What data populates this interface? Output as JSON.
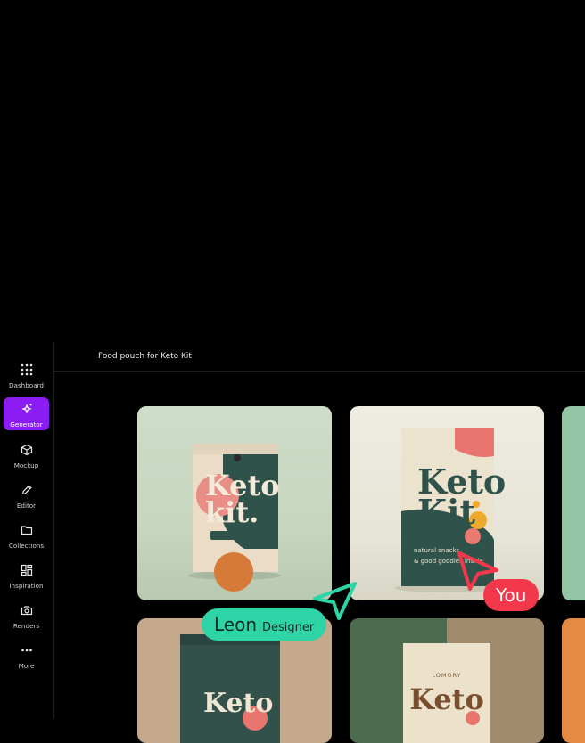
{
  "nav": {
    "items": [
      {
        "label": "Dashboard",
        "icon": "dots-grid-icon"
      },
      {
        "label": "Generator",
        "icon": "sparkle-icon",
        "active": true
      },
      {
        "label": "Mockup",
        "icon": "box-icon"
      },
      {
        "label": "Editor",
        "icon": "pencil-icon"
      },
      {
        "label": "Collections",
        "icon": "folder-icon"
      },
      {
        "label": "Inspiration",
        "icon": "layout-icon"
      },
      {
        "label": "Renders",
        "icon": "camera-icon"
      },
      {
        "label": "More",
        "icon": "ellipsis-icon"
      }
    ]
  },
  "header": {
    "title": "Food pouch for Keto Kit"
  },
  "gallery": {
    "card1": {
      "line1": "Keto",
      "line2": "kit."
    },
    "card2": {
      "line1": "Keto",
      "line2": "Kit",
      "sub1": "natural snacks",
      "sub2": "& good goodies inside"
    },
    "card4": {
      "line1": "Keto"
    },
    "card5": {
      "brand": "LOMORY",
      "line1": "Keto"
    }
  },
  "cursors": {
    "leon": {
      "name": "Leon",
      "role": "Designer",
      "color": "#2ed3a6"
    },
    "you": {
      "name": "You",
      "color": "#f2384a"
    }
  },
  "colors": {
    "accent": "#8b1cf4"
  }
}
